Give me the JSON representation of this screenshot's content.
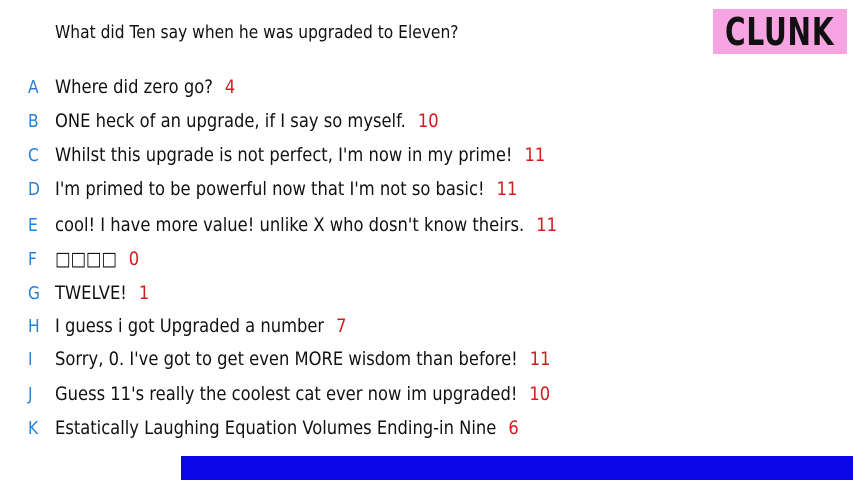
{
  "question": "What did Ten say when he was upgraded to Eleven?",
  "brand": "CLUNK",
  "colors": {
    "brand_bg": "#f7a4e2",
    "letter": "#2a7fd4",
    "score": "#d41c1c",
    "bar": "#0a06e8"
  },
  "answers": [
    {
      "letter": "A",
      "text": "Where did zero go?",
      "score": "4"
    },
    {
      "letter": "B",
      "text": "ONE heck of an upgrade, if I say so myself.",
      "score": "10"
    },
    {
      "letter": "C",
      "text": "Whilst this upgrade is not perfect, I'm now in my prime!",
      "score": "11"
    },
    {
      "letter": "D",
      "text": "I'm primed to be powerful now that I'm not so basic!",
      "score": "11"
    },
    {
      "letter": "E",
      "text": "cool! I have more value! unlike X who dosn't know theirs.",
      "score": "11"
    },
    {
      "letter": "F",
      "text": "□□□□",
      "score": "0"
    },
    {
      "letter": "G",
      "text": "TWELVE!",
      "score": "1"
    },
    {
      "letter": "H",
      "text": "I guess i got Upgraded a number",
      "score": "7"
    },
    {
      "letter": "I",
      "text": "Sorry, 0. I've got to get even MORE wisdom than before!",
      "score": "11"
    },
    {
      "letter": "J",
      "text": "Guess 11's really the coolest cat ever now im upgraded!",
      "score": "10"
    },
    {
      "letter": "K",
      "text": "Estatically Laughing Equation Volumes Ending-in Nine",
      "score": "6"
    }
  ]
}
